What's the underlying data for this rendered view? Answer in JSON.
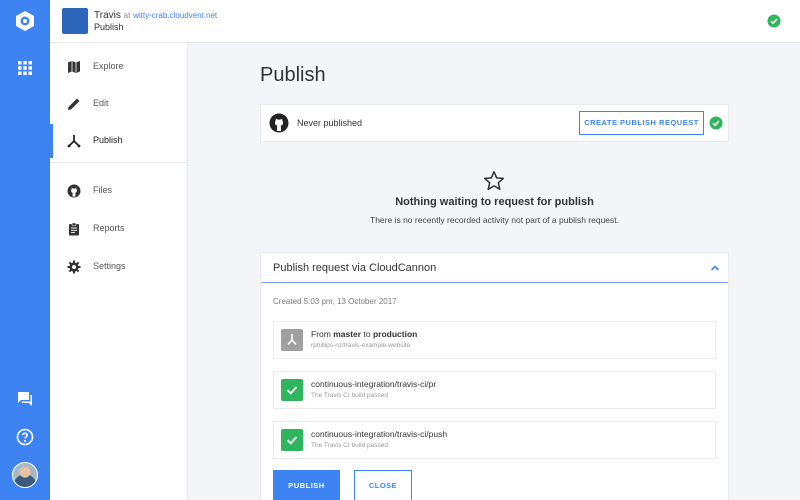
{
  "colors": {
    "accent": "#3d84f2",
    "success": "#2fb55e",
    "neutral_badge": "#a0a0a0"
  },
  "rail": {
    "logo": "cloudcannon-logo",
    "apps_icon": "apps-grid-icon",
    "chat_icon": "chat-icon",
    "help_icon": "help-icon",
    "avatar": "user-avatar"
  },
  "topbar": {
    "user": "Travis",
    "at": "at",
    "domain": "witty-crab.cloudvent.net",
    "breadcrumb": "Publish",
    "status_icon": "check-circle-icon"
  },
  "sidenav": {
    "items": [
      {
        "label": "Explore",
        "icon": "map-icon"
      },
      {
        "label": "Edit",
        "icon": "pencil-icon"
      },
      {
        "label": "Publish",
        "icon": "merge-icon",
        "active": true
      },
      {
        "label": "Files",
        "icon": "github-icon"
      },
      {
        "label": "Reports",
        "icon": "clipboard-icon"
      },
      {
        "label": "Settings",
        "icon": "gear-icon"
      }
    ]
  },
  "page": {
    "title": "Publish"
  },
  "status_card": {
    "text": "Never published",
    "button": "CREATE PUBLISH REQUEST"
  },
  "empty_state": {
    "title": "Nothing waiting to request for publish",
    "subtitle": "There is no recently recorded activity not part of a publish request."
  },
  "publish_request": {
    "title": "Publish request via CloudCannon",
    "created": "Created 5:03 pm, 13 October 2017",
    "merge": {
      "from_word": "From",
      "source": "master",
      "to_word": "to",
      "target": "production",
      "repo": "rphillips-nz/travis-example-website"
    },
    "checks": [
      {
        "name": "continuous-integration/travis-ci/pr",
        "status": "The Travis CI build passed"
      },
      {
        "name": "continuous-integration/travis-ci/push",
        "status": "The Travis CI build passed"
      }
    ],
    "publish_label": "PUBLISH",
    "close_label": "CLOSE"
  }
}
